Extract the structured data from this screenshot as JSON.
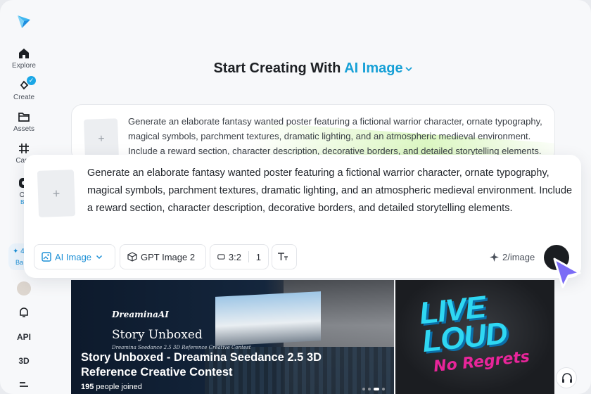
{
  "sidebar": {
    "items": [
      {
        "label": "Explore",
        "icon": "home-icon"
      },
      {
        "label": "Create",
        "icon": "create-icon"
      },
      {
        "label": "Assets",
        "icon": "folder-icon"
      },
      {
        "label": "Canv",
        "icon": "canvas-icon"
      },
      {
        "label": "Oc",
        "icon": "agent-icon"
      }
    ],
    "oc_badge": "Be",
    "promo_top": "✦ 4",
    "promo_bottom": "Ba",
    "lower": {
      "api": "API",
      "three_d": "3D"
    }
  },
  "heading": {
    "prefix": "Start Creating With ",
    "accent": "AI Image"
  },
  "prompt_back": {
    "text": "Generate an elaborate fantasy wanted poster featuring a fictional warrior character, ornate typography, magical symbols, parchment textures, dramatic lighting, and an atmospheric medieval environment. Include a reward section, character description, decorative borders, and detailed storytelling elements."
  },
  "prompt_front": {
    "text": "Generate an elaborate fantasy wanted poster featuring a fictional warrior character, ornate typography, magical symbols, parchment textures, dramatic lighting, and an atmospheric medieval environment. Include a reward section, character description, decorative borders, and detailed storytelling elements."
  },
  "toolbar": {
    "mode": "AI Image",
    "model": "GPT Image 2",
    "ratio": "3:2",
    "count": "1",
    "cost": "2/image"
  },
  "banner1": {
    "brand": "DreaminaAI",
    "script_title": "Story Unboxed",
    "small_line": "Dreamina Seedance 2.5 3D Reference Creative Contest",
    "title": "Story Unboxed - Dreamina Seedance 2.5 3D Reference Creative Contest",
    "joined_count": "195",
    "joined_label": " people joined"
  },
  "banner2": {
    "line1": "LIVE",
    "line2": "LOUD",
    "line3": "No Regrets"
  },
  "colors": {
    "accent": "#17a0d6",
    "send": "#1a1d21",
    "cursor": "#7b6cf6"
  }
}
